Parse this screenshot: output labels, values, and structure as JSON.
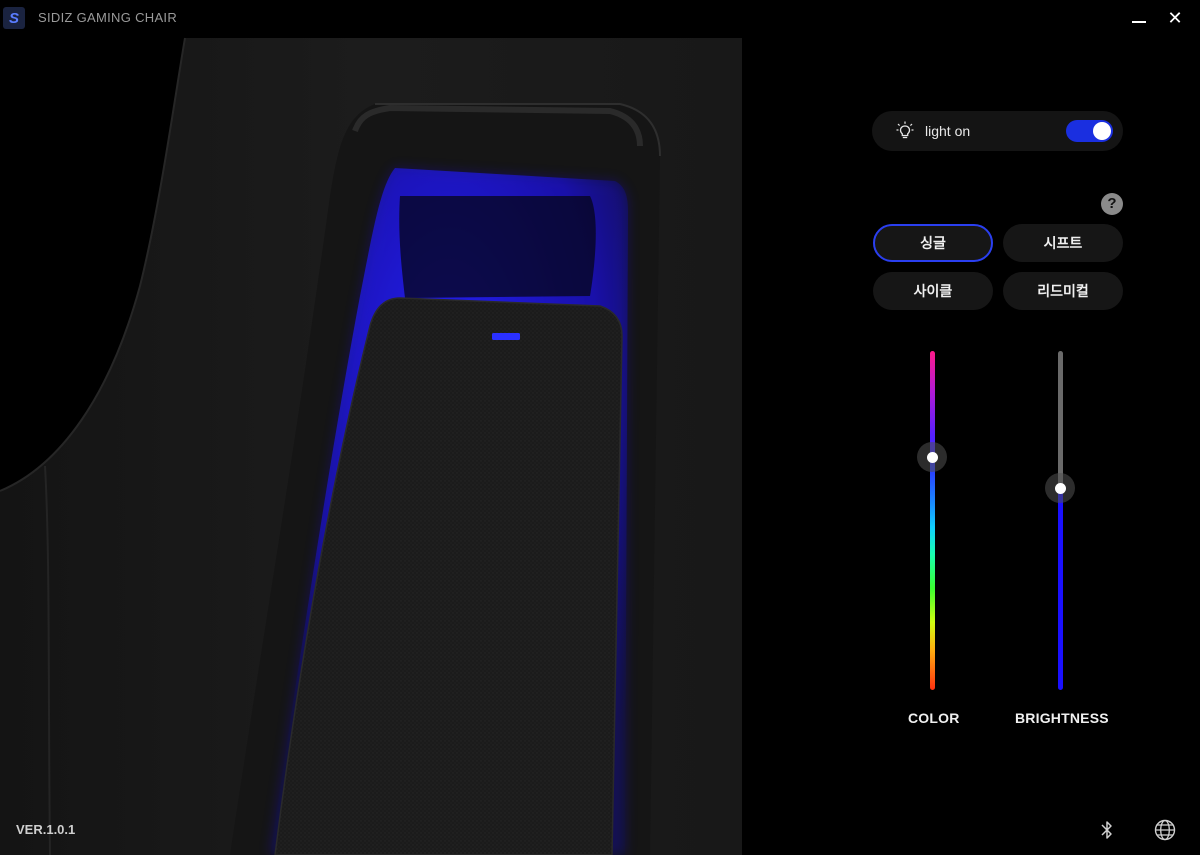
{
  "window": {
    "title": "SIDIZ GAMING CHAIR",
    "logo_letter": "S",
    "minimize_icon": "minimize-icon",
    "close_icon": "close-icon",
    "close_glyph": "✕"
  },
  "light": {
    "label": "light on",
    "icon": "lightbulb-icon",
    "enabled": true,
    "accent_color": "#1a2fe0"
  },
  "help": {
    "label": "?"
  },
  "modes": {
    "selected": "싱글",
    "items": [
      {
        "label": "싱글"
      },
      {
        "label": "시프트"
      },
      {
        "label": "사이클"
      },
      {
        "label": "리드미컬"
      }
    ]
  },
  "sliders": {
    "color": {
      "label": "COLOR",
      "value_fraction_from_top": 0.31
    },
    "brightness": {
      "label": "BRIGHTNESS",
      "value_fraction_from_top": 0.41
    }
  },
  "footer": {
    "version": "VER.1.0.1",
    "bluetooth_icon": "bluetooth-icon",
    "language_icon": "globe-icon"
  },
  "theme": {
    "background": "#000000",
    "glow_color": "#1a10ff"
  }
}
